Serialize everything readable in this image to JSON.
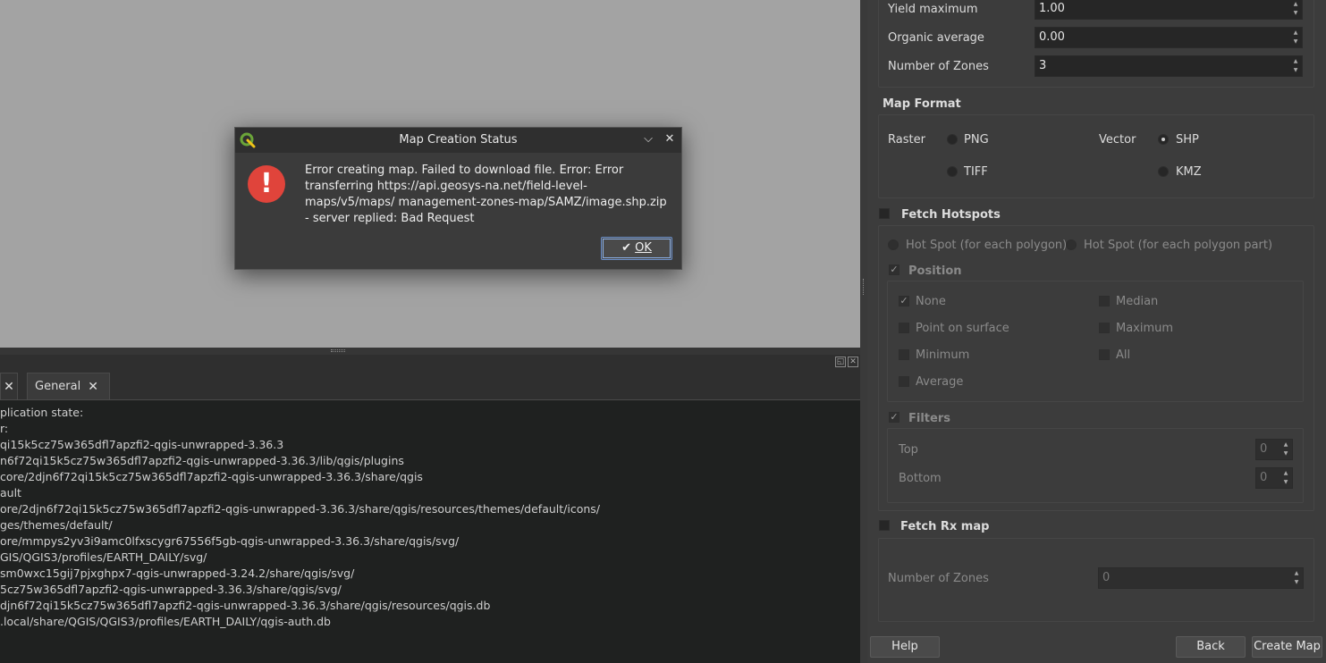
{
  "dialog": {
    "title": "Map Creation Status",
    "message": "Error creating map. Failed to download file. Error: Error transferring https://api.geosys-na.net/field-level-maps/v5/maps/ management-zones-map/SAMZ/image.shp.zip - server replied: Bad Request",
    "ok_label": "OK",
    "error_icon": "!"
  },
  "log": {
    "tabs": [
      {
        "label": ""
      },
      {
        "label": "General"
      }
    ],
    "lines": [
      "plication state:",
      "r:",
      "qi15k5cz75w365dfl7apzfi2-qgis-unwrapped-3.36.3",
      "n6f72qi15k5cz75w365dfl7apzfi2-qgis-unwrapped-3.36.3/lib/qgis/plugins",
      "core/2djn6f72qi15k5cz75w365dfl7apzfi2-qgis-unwrapped-3.36.3/share/qgis",
      "ault",
      "ore/2djn6f72qi15k5cz75w365dfl7apzfi2-qgis-unwrapped-3.36.3/share/qgis/resources/themes/default/icons/",
      "ges/themes/default/",
      "ore/mmpys2yv3i9amc0lfxscygr67556f5gb-qgis-unwrapped-3.36.3/share/qgis/svg/",
      "GIS/QGIS3/profiles/EARTH_DAILY/svg/",
      "sm0wxc15gij7pjxghpx7-qgis-unwrapped-3.24.2/share/qgis/svg/",
      "5cz75w365dfl7apzfi2-qgis-unwrapped-3.36.3/share/qgis/svg/",
      "djn6f72qi15k5cz75w365dfl7apzfi2-qgis-unwrapped-3.36.3/share/qgis/resources/qgis.db",
      ".local/share/QGIS/QGIS3/profiles/EARTH_DAILY/qgis-auth.db"
    ]
  },
  "panel": {
    "yield_max_label": "Yield maximum",
    "yield_max_value": "1.00",
    "organic_avg_label": "Organic average",
    "organic_avg_value": "0.00",
    "num_zones_label": "Number of Zones",
    "num_zones_value": "3",
    "map_format_title": "Map Format",
    "raster_label": "Raster",
    "vector_label": "Vector",
    "png_label": "PNG",
    "tiff_label": "TIFF",
    "shp_label": "SHP",
    "kmz_label": "KMZ",
    "fetch_hotspots_label": "Fetch Hotspots",
    "hotspot_polygon_label": "Hot Spot (for each polygon)",
    "hotspot_part_label": "Hot Spot (for each polygon part)",
    "position_label": "Position",
    "none_label": "None",
    "median_label": "Median",
    "point_surface_label": "Point on surface",
    "maximum_label": "Maximum",
    "minimum_label": "Minimum",
    "all_label": "All",
    "average_label": "Average",
    "filters_label": "Filters",
    "top_label": "Top",
    "top_value": "0",
    "bottom_label": "Bottom",
    "bottom_value": "0",
    "fetch_rx_label": "Fetch Rx map",
    "rx_zones_label": "Number of Zones",
    "rx_zones_value": "0",
    "help_label": "Help",
    "back_label": "Back",
    "create_label": "Create Map"
  },
  "colors": {
    "error_red": "#e0443b",
    "qgis_green": "#6ba539",
    "qgis_yellow": "#f0c419"
  }
}
